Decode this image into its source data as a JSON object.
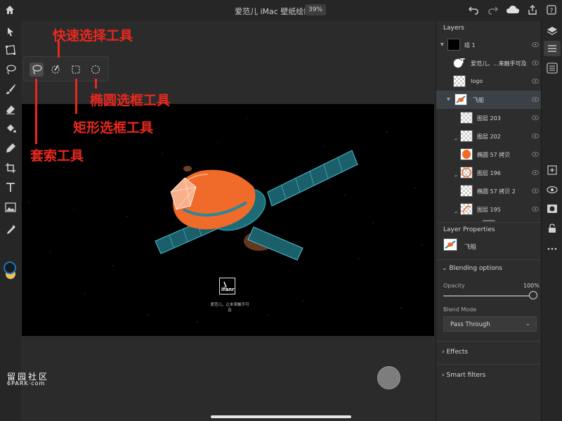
{
  "topbar": {
    "title": "爱范儿 iMac 壁纸绘制",
    "zoom": "39%",
    "icons": [
      "home-icon",
      "undo-icon",
      "redo-icon",
      "cloud-icon",
      "share-icon",
      "help-icon"
    ]
  },
  "toolbar": {
    "tools": [
      "select-icon",
      "transform-icon",
      "lasso-icon",
      "brush-icon",
      "eraser-icon",
      "fill-icon",
      "healing-icon",
      "crop-icon",
      "text-icon",
      "image-icon",
      "eyedropper-icon"
    ],
    "colors": {
      "foreground": "#1a1a1a",
      "foreground_ring": "#1b73c4",
      "background": "#e8c25b"
    }
  },
  "popover": {
    "tools": [
      "lasso-tool",
      "quick-selection-tool",
      "rectangle-marquee-tool",
      "ellipse-marquee-tool"
    ]
  },
  "annotations": {
    "quick_select": "快速选择工具",
    "ellipse": "椭圆选框工具",
    "rect": "矩形选框工具",
    "lasso": "套索工具",
    "color": "#e8281e"
  },
  "canvas": {
    "logo": "ifanr",
    "caption": "爱范儿，让未来触手可及"
  },
  "layers_panel": {
    "title": "Layers",
    "layers": [
      {
        "name": "组 1"
      },
      {
        "name": "爱范儿，...来触手可及"
      },
      {
        "name": "logo"
      },
      {
        "name": "飞船"
      },
      {
        "name": "图层 203"
      },
      {
        "name": "图层 202"
      },
      {
        "name": "椭圆 57 拷贝"
      },
      {
        "name": "图层 196"
      },
      {
        "name": "椭圆 57 拷贝 2"
      },
      {
        "name": "图层 195"
      }
    ]
  },
  "layer_properties": {
    "title": "Layer Properties",
    "layer_name": "飞船",
    "blending_options": "Blending options",
    "opacity_label": "Opacity",
    "opacity_value": "100%",
    "blend_mode_label": "Blend Mode",
    "blend_mode_value": "Pass Through",
    "effects": "Effects",
    "smart_filters": "Smart filters"
  },
  "watermark": {
    "line1": "留园社区",
    "line2": "6PARK·com"
  }
}
